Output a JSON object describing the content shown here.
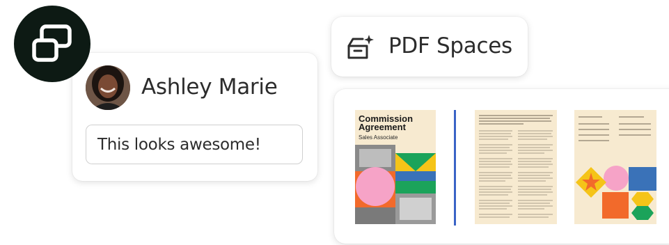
{
  "app_icon": "stacked-windows-icon",
  "comment": {
    "author": "Ashley Marie",
    "text": "This looks awesome!",
    "avatar_icon": "user-avatar"
  },
  "spaces": {
    "label": "PDF Spaces",
    "icon": "sparkle-box-icon"
  },
  "documents": {
    "doc1_title": "Commission Agreement",
    "doc1_subtitle": "Sales Associate"
  },
  "colors": {
    "badge_bg": "#0d1a14",
    "divider": "#3a63c6",
    "paper": "#f7ead0",
    "yellow": "#f5c418",
    "pink": "#f6a3c7",
    "green": "#1ba35a",
    "blue": "#3a72b8",
    "orange": "#f26a2b"
  }
}
